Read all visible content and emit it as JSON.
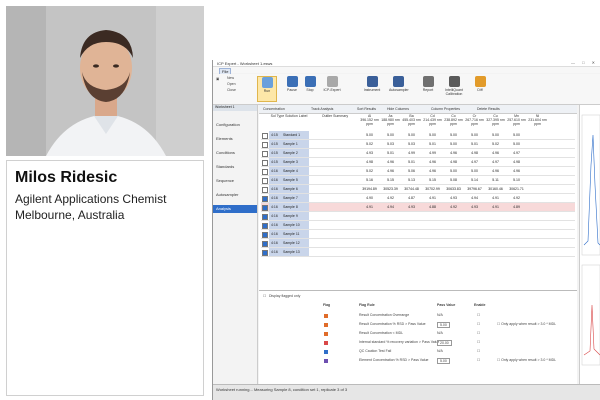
{
  "presenter": {
    "name": "Milos Ridesic",
    "role": "Agilent Applications Chemist",
    "location": "Melbourne, Australia"
  },
  "app": {
    "title": "ICP Expert - Worksheet 1.esws",
    "file_menu": "File",
    "ribbon": [
      {
        "label": "Run",
        "color": "#6aa0dc"
      },
      {
        "label": "Pause",
        "color": "#3b6fb6"
      },
      {
        "label": "Stop",
        "color": "#3b6fb6"
      },
      {
        "label": "ICP-Expert",
        "color": "#a9a9a9"
      },
      {
        "label": "Instrument",
        "color": "#3a5f99"
      },
      {
        "label": "Autosampler",
        "color": "#3a5f99"
      },
      {
        "label": "Report",
        "color": "#707070"
      },
      {
        "label": "IntelliQuant Calibration",
        "color": "#5a5a5a"
      },
      {
        "label": "Diff",
        "color": "#e29b2a"
      }
    ],
    "small_buttons": [
      "New",
      "Open",
      "Close"
    ],
    "worksheet_tab": "Worksheet 1",
    "nav": [
      "Configuration",
      "Elements",
      "Conditions",
      "Standards",
      "Sequence",
      "Autosampler",
      "Analysis"
    ],
    "nav_selected": "Analysis",
    "ws_toolbar": [
      "Concentration",
      "Track Analysis",
      "Sort Results",
      "Hide Columns",
      "Column Properties",
      "Delete Results"
    ],
    "headers": {
      "solution": "Sol Type  Solution Label",
      "summary": "Outlier Summary",
      "elements": [
        "Al\n396.152 nm\nppm",
        "As\n188.980 nm\nppm",
        "Ba\n455.403 nm\nppm",
        "Cd\n214.439 nm\nppm",
        "Co\n238.892 nm\nppm",
        "Cr\n267.716 nm\nppm",
        "Cu\n327.395 nm\nppm",
        "Mn\n257.610 nm\nppm",
        "Ni\n231.604 nm\nppm"
      ]
    },
    "rows": [
      {
        "time": "4:15",
        "label": "Standard 1",
        "checked": false,
        "values": [
          "5.00",
          "5.00",
          "5.00",
          "5.00",
          "5.00",
          "5.00",
          "5.00",
          "5.00"
        ]
      },
      {
        "time": "4:15",
        "label": "Sample 1",
        "checked": false,
        "values": [
          "5.02",
          "5.03",
          "5.03",
          "5.01",
          "5.00",
          "5.01",
          "5.02",
          "5.00"
        ]
      },
      {
        "time": "4:15",
        "label": "Sample 2",
        "checked": false,
        "values": [
          "4.93",
          "5.01",
          "4.99",
          "4.99",
          "4.96",
          "4.98",
          "4.96",
          "4.97"
        ]
      },
      {
        "time": "4:15",
        "label": "Sample 3",
        "checked": false,
        "values": [
          "4.98",
          "4.96",
          "5.01",
          "4.96",
          "4.98",
          "4.97",
          "4.97",
          "4.98"
        ]
      },
      {
        "time": "4:16",
        "label": "Sample 4",
        "checked": false,
        "values": [
          "5.02",
          "4.96",
          "5.06",
          "4.96",
          "5.00",
          "5.00",
          "4.96",
          "4.96"
        ]
      },
      {
        "time": "4:16",
        "label": "Sample 5",
        "checked": false,
        "values": [
          "5.16",
          "5.15",
          "5.13",
          "5.15",
          "5.08",
          "5.14",
          "5.11",
          "5.10"
        ]
      },
      {
        "time": "4:16",
        "label": "Sample 6",
        "checked": false,
        "values": [
          "39194.89",
          "30523.39",
          "30744.48",
          "30702.99",
          "30633.83",
          "39796.67",
          "30160.46",
          "30621.71"
        ]
      },
      {
        "time": "4:16",
        "label": "Sample 7",
        "checked": true,
        "values": [
          "4.90",
          "4.92",
          "4.87",
          "4.91",
          "4.93",
          "4.94",
          "4.91",
          "4.92"
        ]
      },
      {
        "time": "4:16",
        "label": "Sample 8",
        "checked": true,
        "values": [
          "4.91",
          "4.94",
          "4.93",
          "4.88",
          "4.92",
          "4.93",
          "4.91",
          "4.89"
        ],
        "highlight": true
      },
      {
        "time": "4:16",
        "label": "Sample 9",
        "checked": true,
        "values": [
          "",
          "",
          "",
          "",
          "",
          "",
          "",
          ""
        ]
      },
      {
        "time": "4:16",
        "label": "Sample 10",
        "checked": true,
        "values": [
          "",
          "",
          "",
          "",
          "",
          "",
          "",
          ""
        ]
      },
      {
        "time": "4:16",
        "label": "Sample 11",
        "checked": true,
        "values": [
          "",
          "",
          "",
          "",
          "",
          "",
          "",
          ""
        ]
      },
      {
        "time": "4:16",
        "label": "Sample 12",
        "checked": true,
        "values": [
          "",
          "",
          "",
          "",
          "",
          "",
          "",
          ""
        ]
      },
      {
        "time": "4:16",
        "label": "Sample 13",
        "checked": true,
        "values": [
          "",
          "",
          "",
          "",
          "",
          "",
          "",
          ""
        ]
      }
    ],
    "flag_pane": {
      "display_flagged": "Display flagged only",
      "col_flag": "Flag",
      "col_rule": "Flag Rule",
      "col_pass": "Pass Value",
      "col_enable": "Enable",
      "rules": [
        {
          "icon": "#e06c2a",
          "rule": "Result Concentration Overrange",
          "pass": "N/A"
        },
        {
          "icon": "#e06c2a",
          "rule": "Result Concentration % RSD > Pass Value",
          "pass": "5.00"
        },
        {
          "icon": "#e06c2a",
          "rule": "Result Concentration < MDL",
          "pass": "N/A"
        },
        {
          "icon": "#d94848",
          "rule": "Internal standard % recovery variation > Pass Value",
          "pass": "20.00"
        },
        {
          "icon": "#2f6ec9",
          "rule": "QC Caution Test Fail",
          "pass": "N/A"
        },
        {
          "icon": "#6d4fb0",
          "rule": "Element Concentration % RSD > Pass Value",
          "pass": "5.00"
        }
      ],
      "only_apply": "Only apply when result >",
      "only_apply_value": "3.0",
      "mdl_suffix": "* MDL"
    },
    "status": "Worksheet running... Measuring Sample 8, condition set 1, replicate 3 of 3"
  }
}
